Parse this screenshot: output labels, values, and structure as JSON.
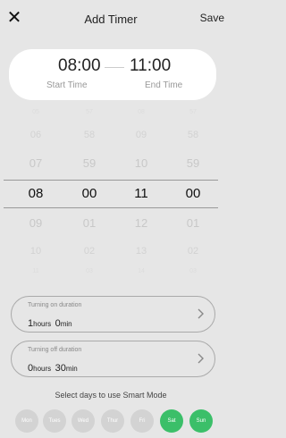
{
  "header": {
    "close_glyph": "✕",
    "title": "Add Timer",
    "save_label": "Save"
  },
  "time_card": {
    "start_time": "08:00",
    "end_time": "11:00",
    "start_label": "Start Time",
    "end_label": "End Time"
  },
  "picker": {
    "columns": [
      [
        "05",
        "06",
        "07",
        "08",
        "09",
        "10",
        "11"
      ],
      [
        "57",
        "58",
        "59",
        "00",
        "01",
        "02",
        "03"
      ],
      [
        "08",
        "09",
        "10",
        "11",
        "12",
        "13",
        "14"
      ],
      [
        "57",
        "58",
        "59",
        "00",
        "01",
        "02",
        "03"
      ]
    ],
    "selected_index": 3
  },
  "turning_on": {
    "label": "Turning on duration",
    "hours_value": "1",
    "hours_unit": "hours",
    "min_value": "0",
    "min_unit": "min"
  },
  "turning_off": {
    "label": "Turning off duration",
    "hours_value": "0",
    "hours_unit": "hours",
    "min_value": "30",
    "min_unit": "min"
  },
  "days": {
    "caption": "Select days to use Smart Mode",
    "items": [
      {
        "label": "Mon",
        "selected": false
      },
      {
        "label": "Tues",
        "selected": false
      },
      {
        "label": "Wed",
        "selected": false
      },
      {
        "label": "Thur",
        "selected": false
      },
      {
        "label": "Fri",
        "selected": false
      },
      {
        "label": "Sat",
        "selected": true
      },
      {
        "label": "Sun",
        "selected": true
      }
    ]
  },
  "colors": {
    "background": "#e6e6e6",
    "selected_day": "#3bbf69",
    "unselected_day": "#d3d3d3"
  }
}
